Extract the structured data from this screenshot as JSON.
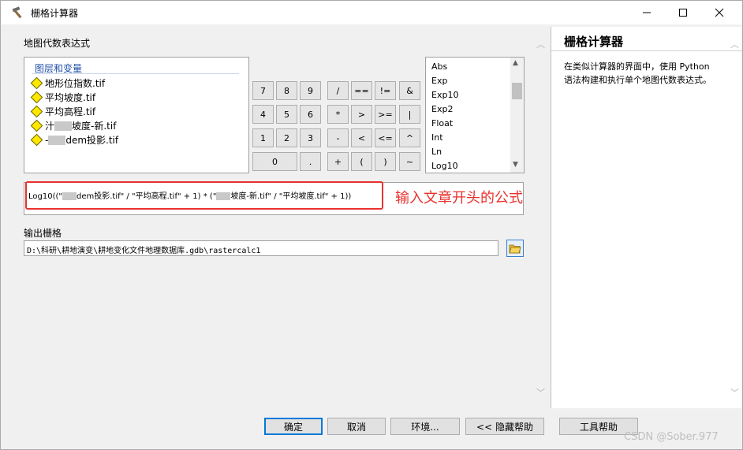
{
  "window": {
    "title": "栅格计算器",
    "icon": "hammer-icon",
    "controls": [
      "minimize-icon",
      "maximize-icon",
      "close-icon"
    ]
  },
  "expression_label": "地图代数表达式",
  "layers": {
    "title": "图层和变量",
    "items": [
      {
        "prefix": "",
        "redacted": false,
        "suffix": "地形位指数.tif"
      },
      {
        "prefix": "",
        "redacted": false,
        "suffix": "平均坡度.tif"
      },
      {
        "prefix": "",
        "redacted": false,
        "suffix": "平均高程.tif"
      },
      {
        "prefix": "汁",
        "redacted": true,
        "suffix": "坡度-新.tif"
      },
      {
        "prefix": "-",
        "redacted": true,
        "suffix": "dem投影.tif"
      }
    ]
  },
  "keypad": {
    "row1": [
      "7",
      "8",
      "9",
      "/",
      "==",
      "!=",
      "&"
    ],
    "row2": [
      "4",
      "5",
      "6",
      "*",
      ">",
      ">=",
      "|"
    ],
    "row3": [
      "1",
      "2",
      "3",
      "-",
      "<",
      "<=",
      "^"
    ],
    "row4": [
      "0",
      ".",
      "+",
      "(",
      ")",
      "~"
    ]
  },
  "functions": [
    "Abs",
    "Exp",
    "Exp10",
    "Exp2",
    "Float",
    "Int",
    "Ln",
    "Log10"
  ],
  "expression": {
    "p1": "Log10((\"",
    "p2": "dem投影.tif\" / \"平均高程.tif\" + 1) * (\"",
    "p3": "坡度-新.tif\" / \"平均坡度.tif\" + 1))"
  },
  "annotation": "输入文章开头的公式",
  "output": {
    "label": "输出栅格",
    "value": "D:\\科研\\耕地演变\\耕地变化文件地理数据库.gdb\\rastercalc1",
    "browse_icon": "folder-open-icon"
  },
  "help": {
    "title": "栅格计算器",
    "body": "在类似计算器的界面中，使用 Python 语法构建和执行单个地图代数表达式。"
  },
  "buttons": {
    "ok": "确定",
    "cancel": "取消",
    "env": "环境...",
    "hide_help": "<< 隐藏帮助",
    "tool_help": "工具帮助"
  },
  "watermark": "CSDN @Sober.977"
}
